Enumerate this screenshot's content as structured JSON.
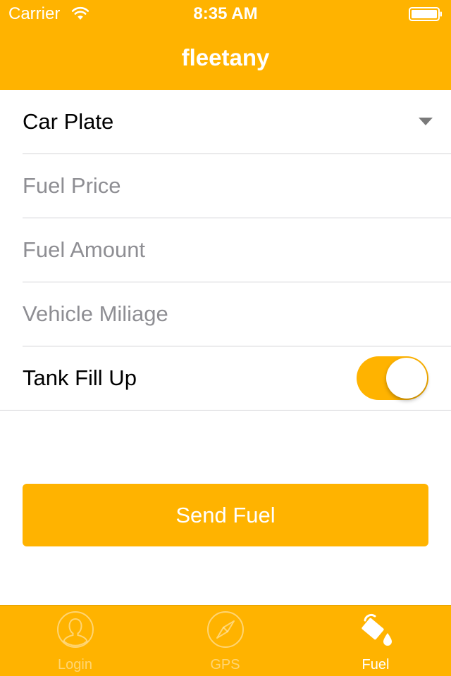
{
  "status_bar": {
    "carrier": "Carrier",
    "time": "8:35 AM",
    "wifi_icon": "wifi-icon",
    "battery_icon": "battery-icon"
  },
  "header": {
    "title": "fleetany"
  },
  "form": {
    "car_plate": {
      "label": "Car Plate",
      "icon": "caret-down-icon"
    },
    "fuel_price": {
      "value": "",
      "placeholder": "Fuel Price"
    },
    "fuel_amount": {
      "value": "",
      "placeholder": "Fuel Amount"
    },
    "vehicle_miliage": {
      "value": "",
      "placeholder": "Vehicle Miliage"
    },
    "tank_fill_up": {
      "label": "Tank Fill Up",
      "on": true
    }
  },
  "send_button": {
    "label": "Send Fuel"
  },
  "tab_bar": {
    "tabs": [
      {
        "label": "Login",
        "icon": "user-icon",
        "active": false
      },
      {
        "label": "GPS",
        "icon": "compass-icon",
        "active": false
      },
      {
        "label": "Fuel",
        "icon": "fuel-bucket-icon",
        "active": true
      }
    ]
  },
  "colors": {
    "accent": "#FFB300",
    "text": "#000000",
    "placeholder": "#8E8E93",
    "separator": "#D3D3D6",
    "white": "#FFFFFF"
  }
}
